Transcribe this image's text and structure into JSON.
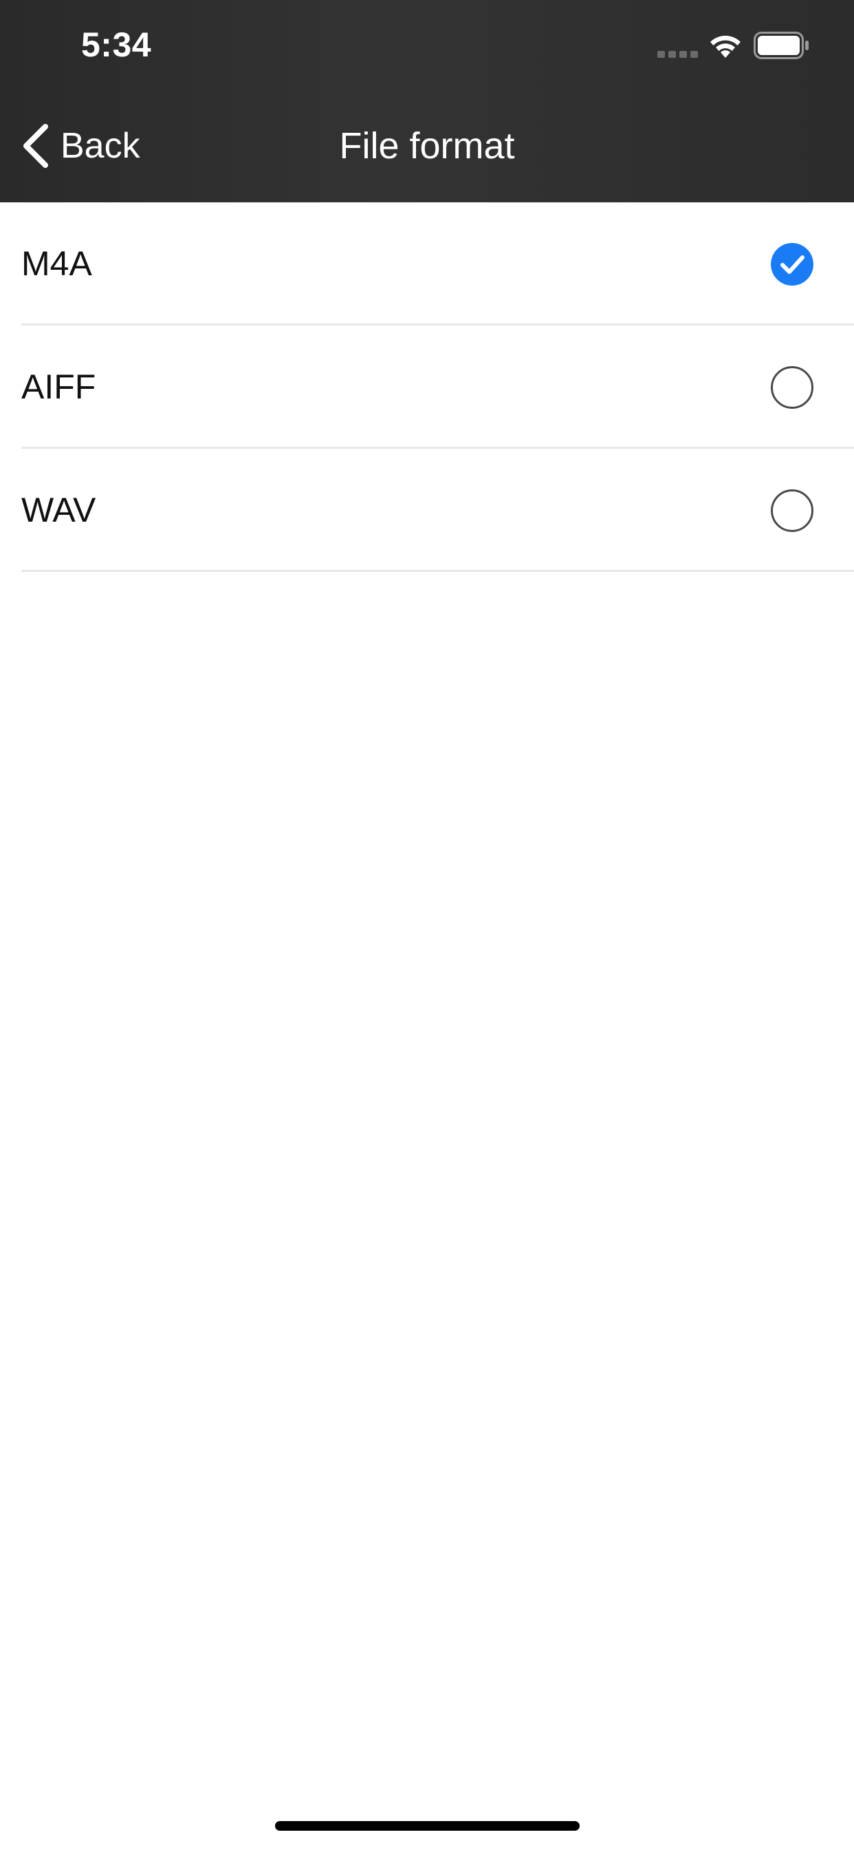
{
  "status_bar": {
    "time": "5:34",
    "signal_icon": "cellular-signal-icon",
    "wifi_icon": "wifi-icon",
    "battery_icon": "battery-icon"
  },
  "nav": {
    "back_label": "Back",
    "back_icon": "chevron-left-icon",
    "title": "File format"
  },
  "formats": [
    {
      "label": "M4A",
      "selected": true
    },
    {
      "label": "AIFF",
      "selected": false
    },
    {
      "label": "WAV",
      "selected": false
    }
  ],
  "colors": {
    "header_bg": "#2f2f2f",
    "accent": "#1a7cf5",
    "radio_border": "#4a4a4a",
    "separator": "#e8e8e8",
    "text": "#111111"
  }
}
